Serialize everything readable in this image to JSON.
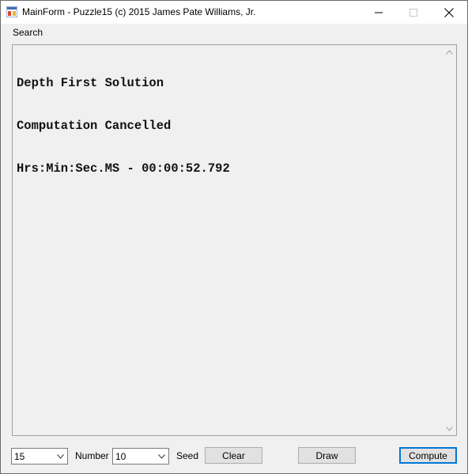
{
  "window": {
    "title": "MainForm - Puzzle15 (c) 2015 James Pate Williams, Jr.",
    "icons": {
      "app": "app-icon",
      "minimize": "minimize-icon",
      "maximize": "maximize-icon",
      "close": "close-icon"
    }
  },
  "menu": {
    "items": [
      {
        "label": "Search"
      }
    ]
  },
  "output": {
    "lines": [
      "Depth First Solution",
      "Computation Cancelled",
      "Hrs:Min:Sec.MS - 00:00:52.792"
    ]
  },
  "controls": {
    "size_combo": {
      "value": "15"
    },
    "number_label": "Number",
    "number_combo": {
      "value": "10"
    },
    "seed_label": "Seed",
    "clear_button": "Clear",
    "draw_button": "Draw",
    "compute_button": "Compute"
  },
  "colors": {
    "accent": "#0078d7",
    "window_bg": "#f0f0f0"
  }
}
